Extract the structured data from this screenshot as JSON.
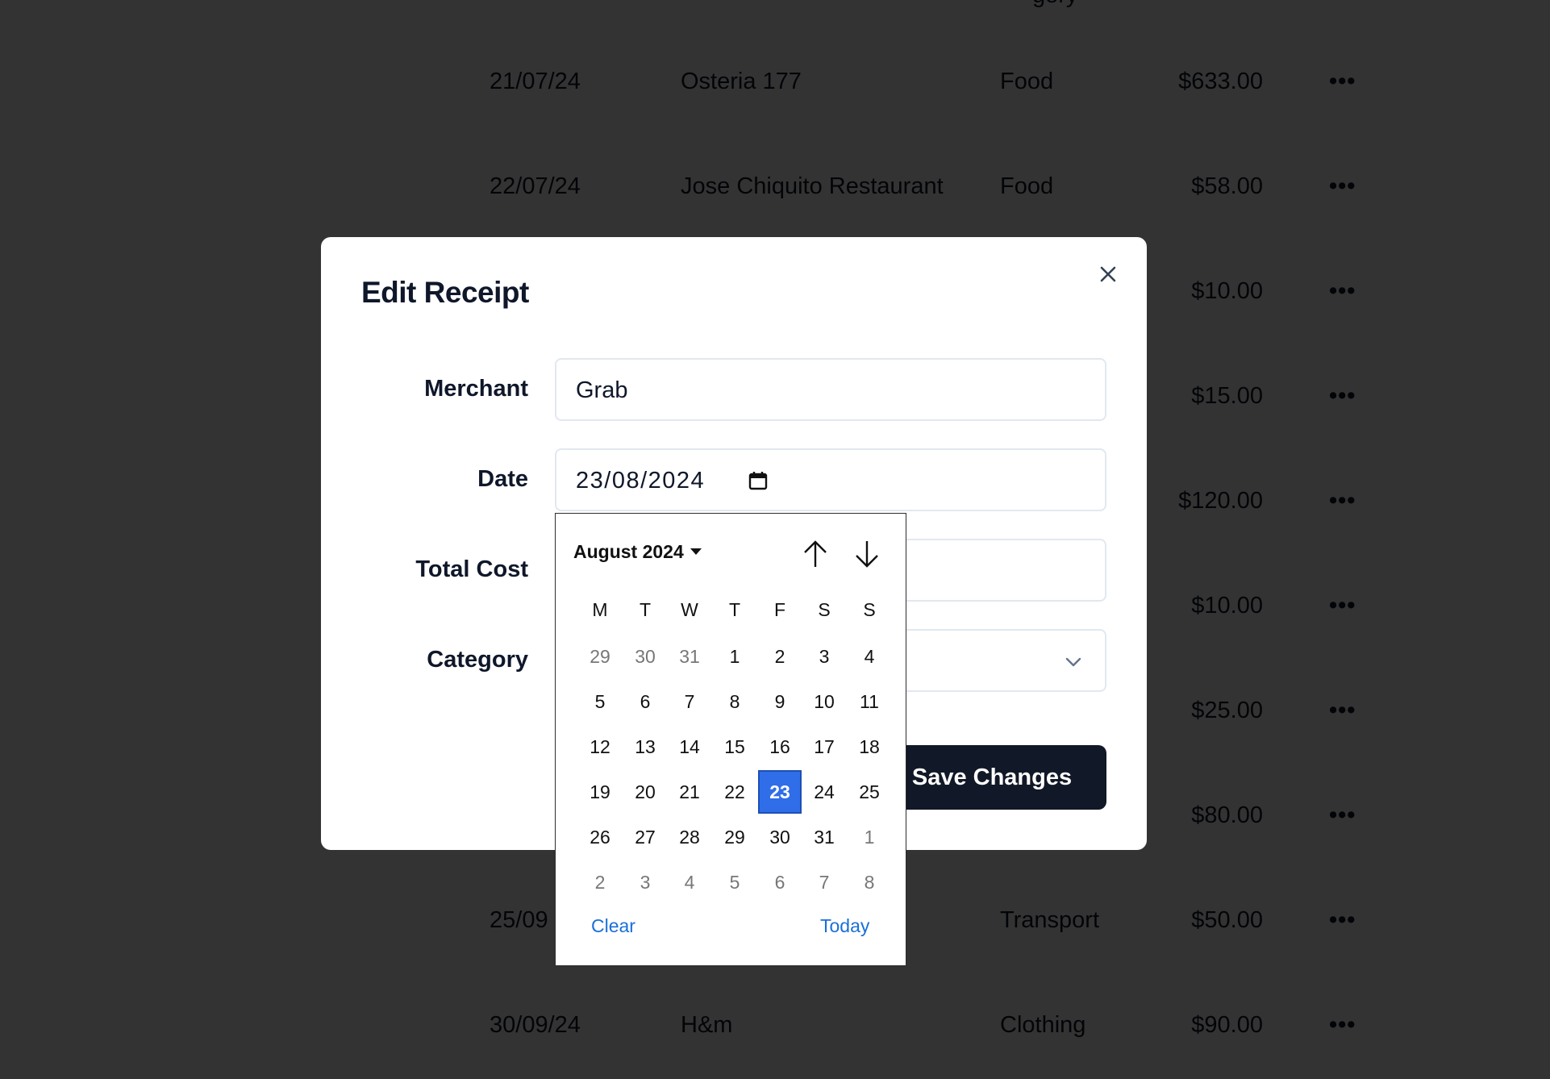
{
  "table": {
    "header_partial": "gory",
    "rows": [
      {
        "date": "21/07/24",
        "merchant": "Osteria 177",
        "category": "Food",
        "amount": "$633.00",
        "more": "•••"
      },
      {
        "date": "22/07/24",
        "merchant": "Jose Chiquito Restaurant",
        "category": "Food",
        "amount": "$58.00",
        "more": "•••"
      },
      {
        "date": "",
        "merchant": "",
        "category": "",
        "amount": "$10.00",
        "more": "•••"
      },
      {
        "date": "",
        "merchant": "",
        "category": "",
        "amount": "$15.00",
        "more": "•••"
      },
      {
        "date": "",
        "merchant": "",
        "category": "",
        "amount": "$120.00",
        "more": "•••"
      },
      {
        "date": "",
        "merchant": "",
        "category": "",
        "amount": "$10.00",
        "more": "•••"
      },
      {
        "date": "",
        "merchant": "",
        "category": "",
        "amount": "$25.00",
        "more": "•••"
      },
      {
        "date": "",
        "merchant": "",
        "category": "",
        "amount": "$80.00",
        "more": "•••"
      },
      {
        "date": "25/09",
        "merchant": "",
        "category": "Transport",
        "amount": "$50.00",
        "more": "•••"
      },
      {
        "date": "30/09/24",
        "merchant": "H&m",
        "category": "Clothing",
        "amount": "$90.00",
        "more": "•••"
      }
    ]
  },
  "modal": {
    "title": "Edit Receipt",
    "close_icon": "close-icon",
    "fields": {
      "merchant": {
        "label": "Merchant",
        "value": "Grab"
      },
      "date": {
        "label": "Date",
        "value": "23/08/2024"
      },
      "total_cost": {
        "label": "Total Cost",
        "value": ""
      },
      "category": {
        "label": "Category",
        "value": ""
      }
    },
    "save_label": "Save Changes"
  },
  "datepicker": {
    "month_label": "August 2024",
    "weekdays": [
      "M",
      "T",
      "W",
      "T",
      "F",
      "S",
      "S"
    ],
    "weeks": [
      [
        [
          "29",
          true
        ],
        [
          "30",
          true
        ],
        [
          "31",
          true
        ],
        [
          "1",
          false
        ],
        [
          "2",
          false
        ],
        [
          "3",
          false
        ],
        [
          "4",
          false
        ]
      ],
      [
        [
          "5",
          false
        ],
        [
          "6",
          false
        ],
        [
          "7",
          false
        ],
        [
          "8",
          false
        ],
        [
          "9",
          false
        ],
        [
          "10",
          false
        ],
        [
          "11",
          false
        ]
      ],
      [
        [
          "12",
          false
        ],
        [
          "13",
          false
        ],
        [
          "14",
          false
        ],
        [
          "15",
          false
        ],
        [
          "16",
          false
        ],
        [
          "17",
          false
        ],
        [
          "18",
          false
        ]
      ],
      [
        [
          "19",
          false
        ],
        [
          "20",
          false
        ],
        [
          "21",
          false
        ],
        [
          "22",
          false
        ],
        [
          "23",
          false
        ],
        [
          "24",
          false
        ],
        [
          "25",
          false
        ]
      ],
      [
        [
          "26",
          false
        ],
        [
          "27",
          false
        ],
        [
          "28",
          false
        ],
        [
          "29",
          false
        ],
        [
          "30",
          false
        ],
        [
          "31",
          false
        ],
        [
          "1",
          true
        ]
      ],
      [
        [
          "2",
          true
        ],
        [
          "3",
          true
        ],
        [
          "4",
          true
        ],
        [
          "5",
          true
        ],
        [
          "6",
          true
        ],
        [
          "7",
          true
        ],
        [
          "8",
          true
        ]
      ]
    ],
    "selected_day": "23",
    "clear_label": "Clear",
    "today_label": "Today",
    "accent_color": "#2f6ee8"
  }
}
